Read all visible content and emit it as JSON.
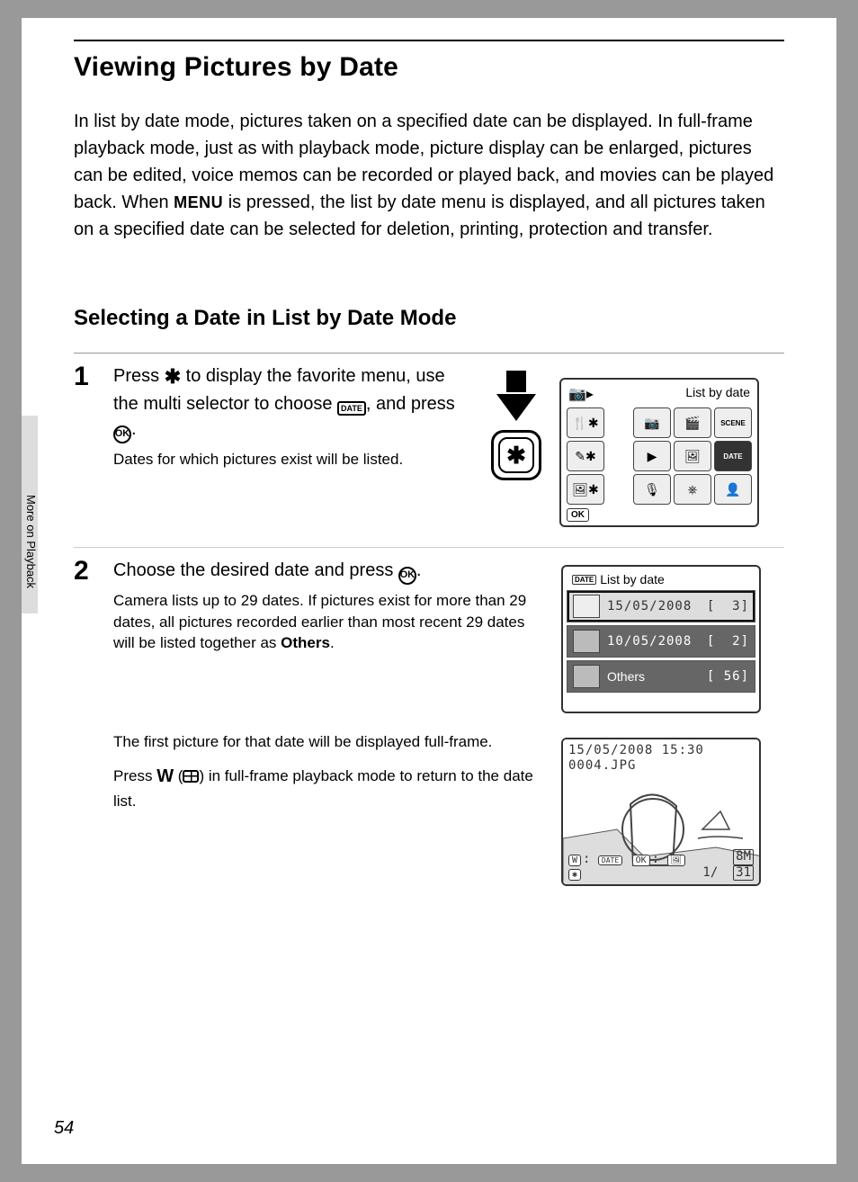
{
  "page_number": "54",
  "side_tab": "More on Playback",
  "title": "Viewing Pictures by Date",
  "intro_parts": {
    "a": "In list by date mode, pictures taken on a specified date can be displayed. In full-frame playback mode, just as with playback mode, picture display can be enlarged, pictures can be edited, voice memos can be recorded or played back, and movies can be played back. When ",
    "menu": "MENU",
    "b": " is pressed, the list by date menu is displayed, and all pictures taken on a specified date can be selected for deletion, printing, protection and transfer."
  },
  "subhead": "Selecting a Date in List by Date Mode",
  "step1": {
    "num": "1",
    "line_a": "Press ",
    "line_b": " to display the favorite menu, use the multi selector to choose ",
    "line_c": ", and press ",
    "line_d": ".",
    "sub": "Dates for which pictures exist will be listed.",
    "ast": "✱",
    "date_label": "DATE",
    "ok_label": "OK"
  },
  "screen1": {
    "header_icon": "📷▸",
    "header_text": "List by date",
    "tiles": [
      [
        "🍴✱",
        "",
        "📷",
        "🎬",
        "SCENE"
      ],
      [
        "✎✱",
        "",
        "▶",
        "🖼",
        "DATE"
      ],
      [
        "🖼✱",
        "",
        "🎙",
        "⎈",
        "👤"
      ]
    ],
    "footer_ok": "OK"
  },
  "step2": {
    "num": "2",
    "line_a": "Choose the desired date and press ",
    "line_b": ".",
    "sub_a": "Camera lists up to 29 dates. If pictures exist for more than 29 dates, all pictures recorded earlier than most recent 29 dates will be listed together as ",
    "sub_b": "Others",
    "sub_c": ".",
    "para2_a": "The first picture for that date will be displayed full-frame.",
    "para2_b_a": "Press ",
    "para2_b_w": "W",
    "para2_b_b": " (",
    "para2_b_c": ") in full-frame playback mode to return to the date list."
  },
  "screen2": {
    "title": "List by date",
    "rows": [
      {
        "date": "15/05/2008",
        "count": "3",
        "sel": true
      },
      {
        "date": "10/05/2008",
        "count": "2",
        "sel": false
      },
      {
        "date": "Others",
        "count": "56",
        "sel": false
      }
    ]
  },
  "screen3": {
    "line1": "15/05/2008 15:30",
    "line2": "0004.JPG",
    "bottom_left_pills": [
      "W",
      "DATE",
      "OK",
      "🖼",
      "✱"
    ],
    "frame": "1/",
    "size": "8M",
    "pics": "31"
  }
}
